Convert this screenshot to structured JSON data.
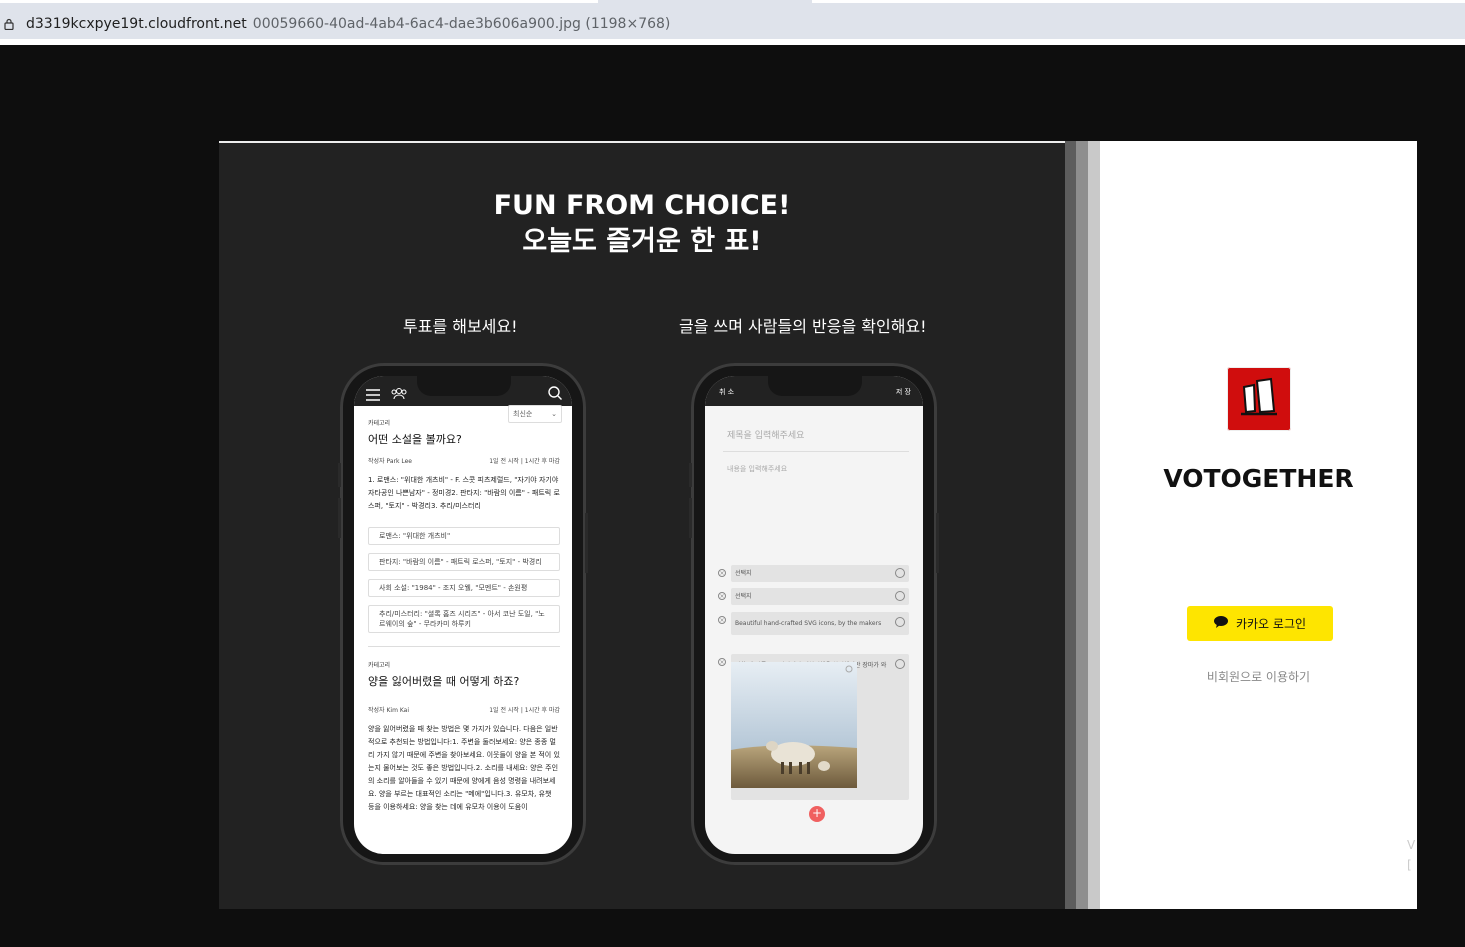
{
  "browser": {
    "url_host": "d3319kcxpye19t.cloudfront.net",
    "url_path": "00059660-40ad-4ab4-6ac4-dae3b606a900.jpg (1198×768)"
  },
  "promo": {
    "headline_1": "FUN FROM CHOICE!",
    "headline_2": "오늘도 즐거운 한 표!",
    "subtitle_vote": "투표를 해보세요!",
    "subtitle_write": "글을 쓰며 사람들의 반응을 확인해요!"
  },
  "phone_feed": {
    "sort_label": "최신순",
    "posts": [
      {
        "category": "카테고리",
        "title": "어떤 소설을 볼까요?",
        "author": "작성자  Park Lee",
        "time": "1일 전 시작 | 1시간 후 마감",
        "body": "1. 로맨스: \"위대한 개츠비\" - F. 스콧 피츠제럴드, \"자기야 자기야 자타공인 나쁜남자\" - 정미경2. 판타지: \"바람의 이름\" - 패트릭 로스퍼, \"토지\" - 박경리3. 추리/미스터리",
        "options": [
          "로맨스: \"위대한 개츠비\"",
          "판타지: \"바람의 이름\" - 패트릭 로스퍼, \"토지\" - 박경리",
          "사회 소설: \"1984\" - 조지 오웰, \"모멘트\" - 손원평",
          "추리/미스터리: \"셜록 홈즈 시리즈\" - 아서 코난 도일, \"노르웨이의 숲\" - 무라카미 하루키"
        ]
      },
      {
        "category": "카테고리",
        "title": "양을 잃어버렸을 때 어떻게 하죠?",
        "author": "작성자  Kim Kai",
        "time": "1일 전 시작 | 1시간 후 마감",
        "body": "양을 잃어버렸을 때 찾는 방법은 몇 가지가 있습니다. 다음은 일반적으로 추천되는 방법입니다:1. 주변을 둘러보세요: 양은 종종 멀리 가지 않기 때문에 주변을 찾아보세요. 이웃들이 양을 본 적이 있는지 물어보는 것도 좋은 방법입니다.2. 소리를 내세요: 양은 주인의 소리를 알아들을 수 있기 때문에 양에게 음성 명령을 내려보세요. 양을 부르는 대표적인 소리는 \"메에\"입니다.3. 유모차, 유챗 등을 이용하세요: 양을 찾는 데에 유모차 이용이 도움이"
      }
    ]
  },
  "phone_editor": {
    "cancel": "취 소",
    "save": "저 장",
    "title_placeholder": "제목을 입력해주세요",
    "body_placeholder": "내용을 입력해주세요",
    "choices": [
      "선택지",
      "선택지",
      "Beautiful hand-crafted SVG icons, by the makers",
      "방학 때 강릉으로 강아지와 기차여행을 하려했지만 장마가 와서 취소했어요. 여행을 별로 좋"
    ]
  },
  "login": {
    "brand": "VOTOGETHER",
    "kakao_label": "카카오 로그인",
    "guest_label": "비회원으로 이용하기",
    "edge_text_1": "V",
    "edge_text_2": "["
  },
  "colors": {
    "kakao_yellow": "#fee500",
    "brand_red": "#d00d0d"
  }
}
